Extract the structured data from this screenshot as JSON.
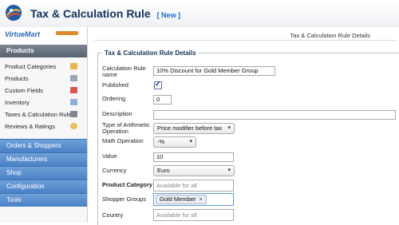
{
  "header": {
    "title": "Tax & Calculation Rule",
    "tag": "[ New ]"
  },
  "sidebar": {
    "logo_text": "VirtueMart",
    "products_header": "Products",
    "items": [
      {
        "label": "Product Categories",
        "icon": "folder-icon",
        "color": "#e8b64a"
      },
      {
        "label": "Products",
        "icon": "image-icon",
        "color": "#9aa6b4"
      },
      {
        "label": "Custom Fields",
        "icon": "custom-fields-icon",
        "color": "#d9534f"
      },
      {
        "label": "Inventory",
        "icon": "inventory-icon",
        "color": "#8fb0d6"
      },
      {
        "label": "Taxes & Calculation Rules",
        "icon": "calculator-icon",
        "color": "#7d8792"
      },
      {
        "label": "Reviews & Ratings",
        "icon": "speech-bubble-icon",
        "color": "#e8c25a"
      }
    ],
    "sections": [
      {
        "label": "Orders & Shoppers"
      },
      {
        "label": "Manufacturers"
      },
      {
        "label": "Shop"
      },
      {
        "label": "Configuration"
      },
      {
        "label": "Tools"
      }
    ]
  },
  "main": {
    "breadcrumb": "Tax & Calculation Rule Details",
    "legend": "Tax & Calculation Rule Details",
    "fields": {
      "name_label": "Calculation Rule name",
      "name_value": "10% Discount for Gold Member Group",
      "published_label": "Published",
      "published_checked": true,
      "ordering_label": "Ordering",
      "ordering_value": "0",
      "description_label": "Description",
      "description_value": "",
      "arith_label": "Type of Arithmetic Operation",
      "arith_value": "Price modifier before tax",
      "math_label": "Math Operation",
      "math_value": "-%",
      "value_label": "Value",
      "value_value": "10",
      "currency_label": "Currency",
      "currency_value": "Euro",
      "category_label": "Product Category",
      "category_placeholder": "Available for all",
      "groups_label": "Shopper Groups",
      "groups_chip": "Gold Member",
      "groups_chip_remove": "×",
      "country_label": "Country",
      "country_placeholder": "Available for all"
    }
  },
  "colors": {
    "accent": "#4a82c7",
    "title": "#16325c",
    "tag": "#1a6ec7"
  }
}
